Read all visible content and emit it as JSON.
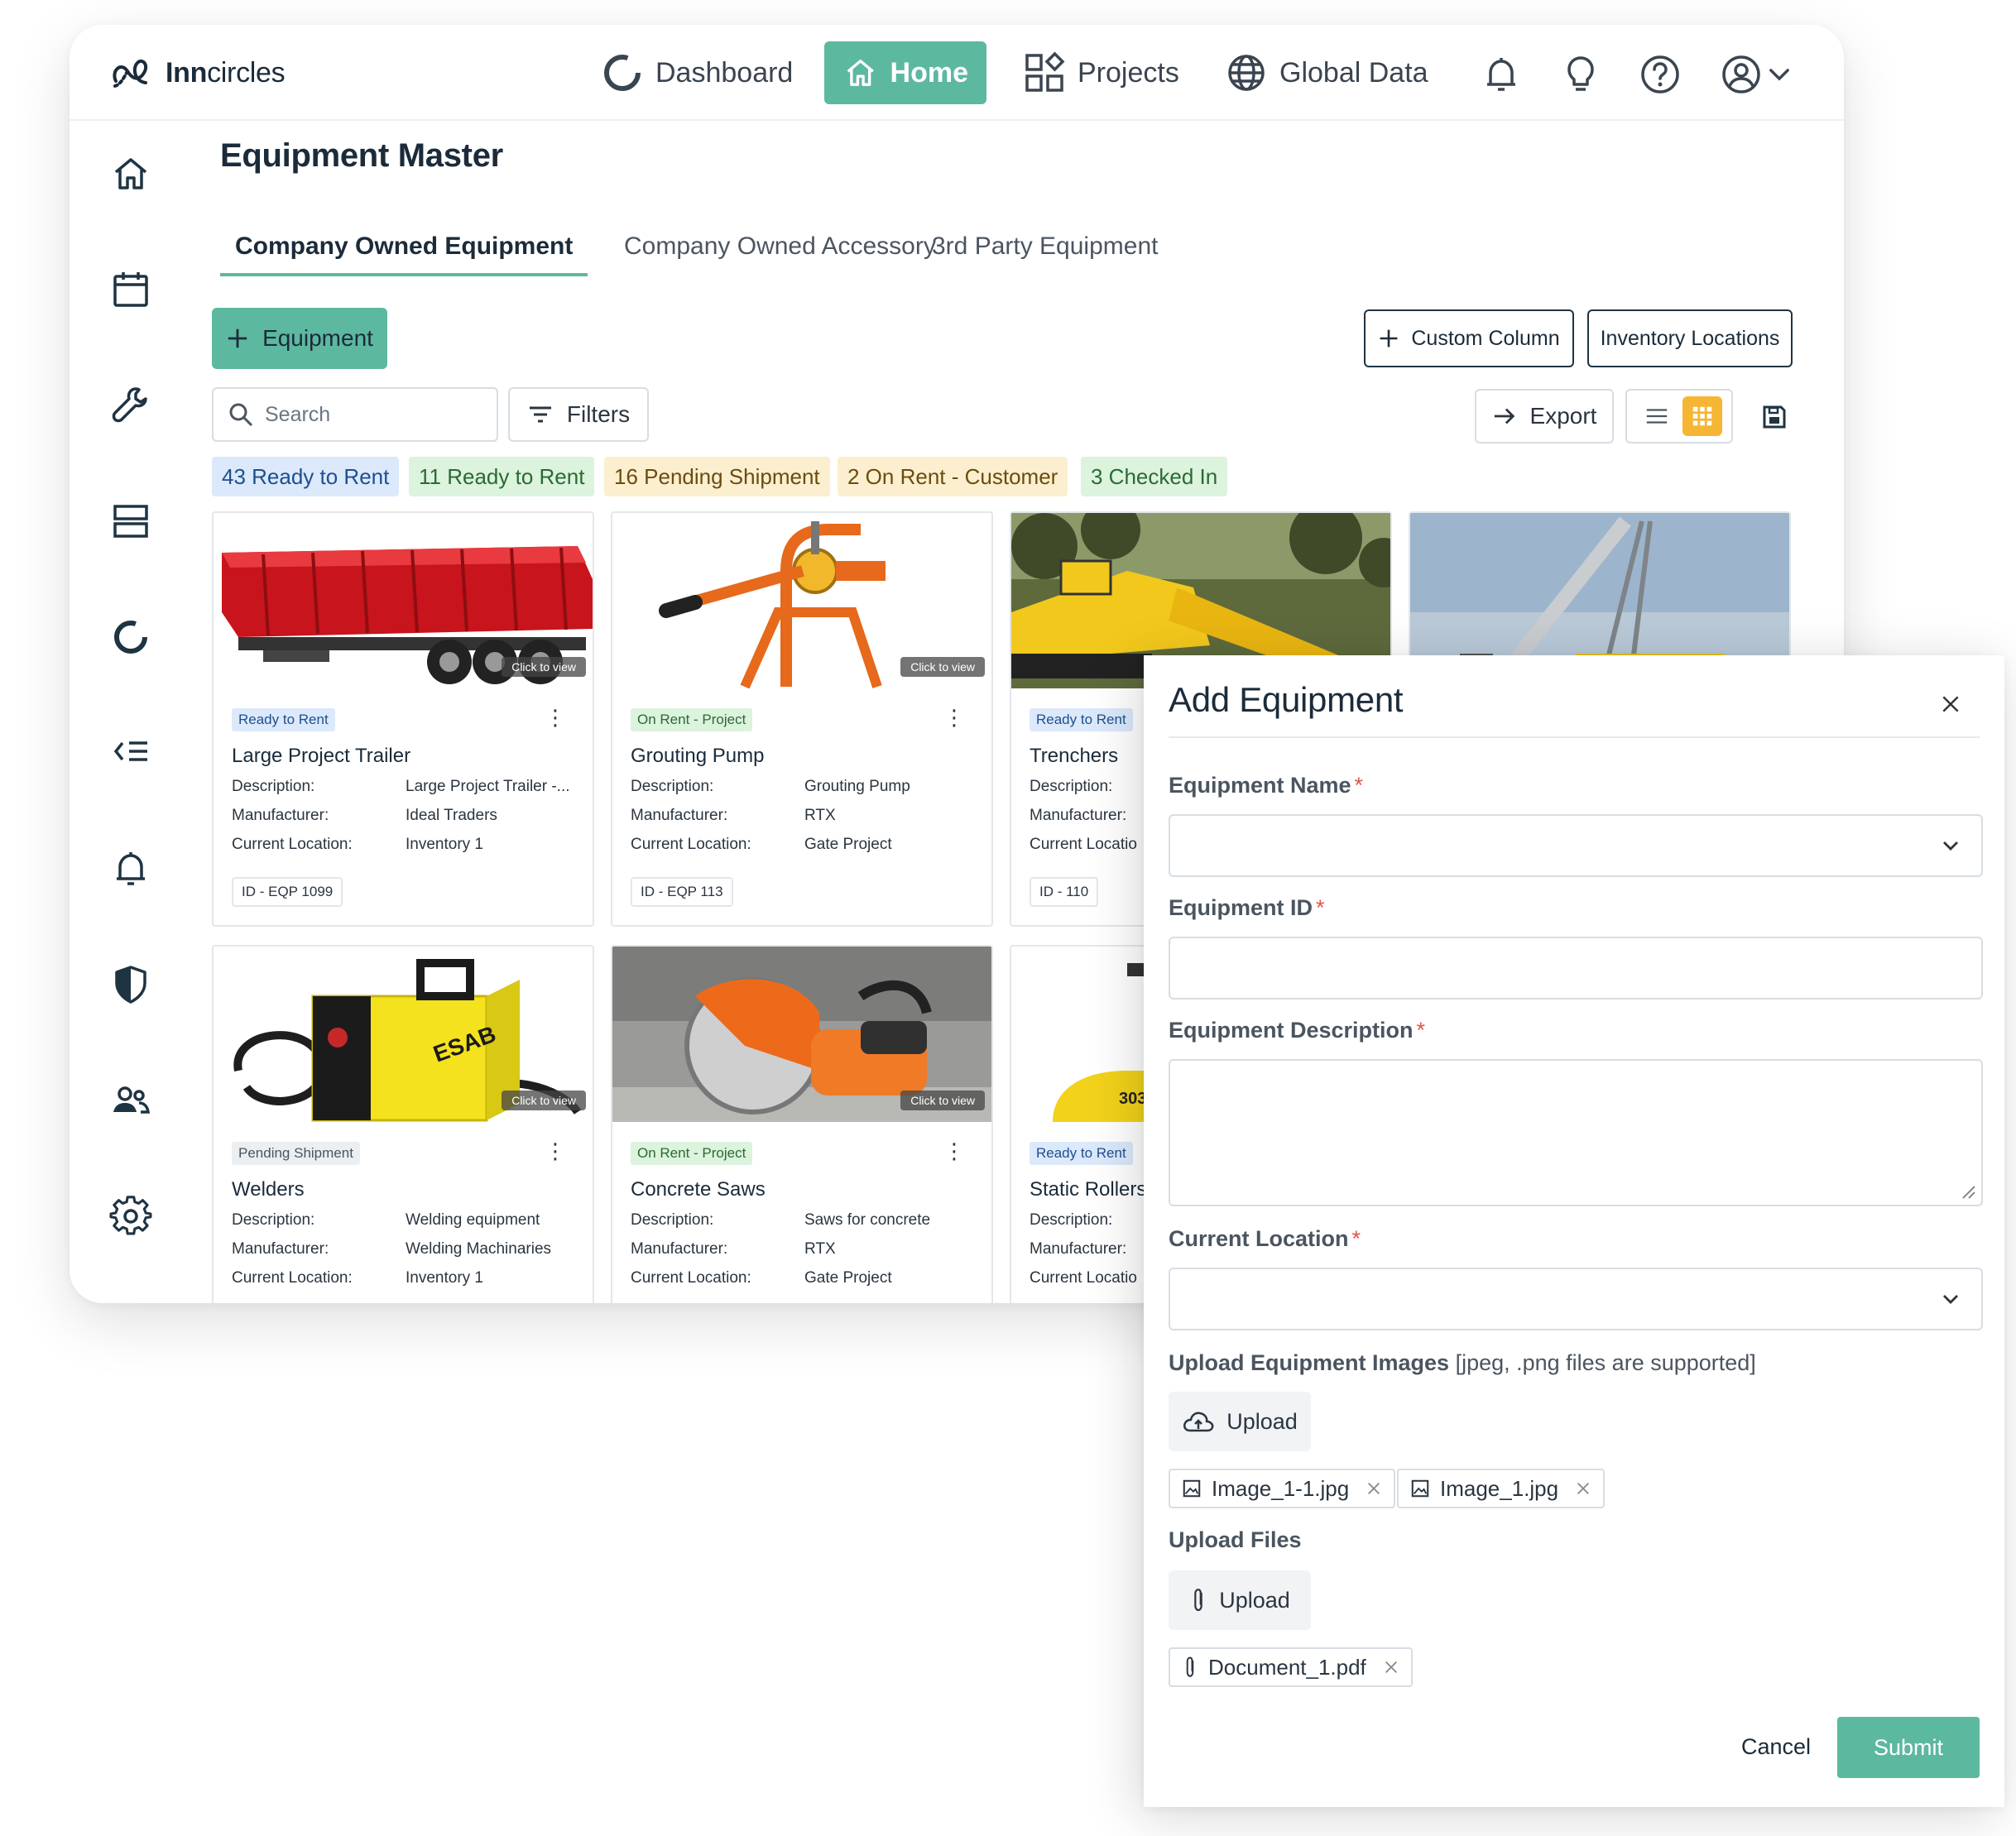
{
  "app": {
    "logo_prefix": "Inn",
    "logo_suffix": "circles",
    "nav": [
      {
        "label": "Dashboard",
        "icon": "dashboard-ring-icon"
      },
      {
        "label": "Home",
        "icon": "home-icon",
        "active": true
      },
      {
        "label": "Projects",
        "icon": "projects-grid-icon"
      },
      {
        "label": "Global Data",
        "icon": "globe-icon"
      }
    ],
    "header_icons": [
      "bell-icon",
      "lightbulb-icon",
      "help-icon",
      "account-icon",
      "chevron-down-icon"
    ],
    "accent_color": "#5db8a0"
  },
  "sidebar": {
    "icons": [
      "home-icon",
      "calendar-icon",
      "wrench-icon",
      "storage-icon",
      "ring-chart-icon",
      "list-icon",
      "bell-icon",
      "shield-icon",
      "users-icon",
      "settings-gear-icon"
    ]
  },
  "page": {
    "title": "Equipment Master",
    "tabs": [
      "Company Owned Equipment",
      "Company Owned Accessory",
      "3rd Party Equipment"
    ],
    "active_tab": "Company Owned Equipment"
  },
  "toolbar": {
    "add_equipment": "Equipment",
    "custom_column": "Custom Column",
    "inventory_locations": "Inventory Locations",
    "search_placeholder": "Search",
    "filters": "Filters",
    "export": "Export",
    "view_mode": "grid"
  },
  "status_chips": [
    {
      "label": "43 Ready to Rent",
      "bg": "#dbe9fb",
      "color": "#1e4f8f"
    },
    {
      "label": "11 Ready to Rent",
      "bg": "#dcf3dd",
      "color": "#2b6a34"
    },
    {
      "label": "16 Pending Shipment",
      "bg": "#fbefcf",
      "color": "#6b4c10"
    },
    {
      "label": "2 On Rent - Customer",
      "bg": "#fbefcf",
      "color": "#6b4c10"
    },
    {
      "label": "3 Checked In",
      "bg": "#dcf3dd",
      "color": "#2b6a34"
    }
  ],
  "card_labels": {
    "description": "Description:",
    "manufacturer": "Manufacturer:",
    "current_location": "Current Location:",
    "current_location_truncated": "Current Locatio",
    "click_to_view": "Click to view"
  },
  "cards": [
    {
      "status": "Ready to Rent",
      "name": "Large Project Trailer",
      "description": "Large Project Trailer -...",
      "manufacturer": "Ideal Traders",
      "location": "Inventory 1",
      "id": "ID - EQP 1099"
    },
    {
      "status": "On Rent - Project",
      "name": "Grouting Pump",
      "description": "Grouting Pump",
      "manufacturer": "RTX",
      "location": "Gate Project",
      "id": "ID - EQP 113"
    },
    {
      "status": "Ready to Rent",
      "name": "Trenchers",
      "id": "ID - 110"
    },
    {
      "status": "Pending Shipment",
      "name": "Welders",
      "description": "Welding equipment",
      "manufacturer": "Welding Machinaries",
      "location": "Inventory 1"
    },
    {
      "status": "On Rent - Project",
      "name": "Concrete Saws",
      "description": "Saws for concrete",
      "manufacturer": "RTX",
      "location": "Gate Project"
    },
    {
      "status": "Ready to Rent",
      "name": "Static Rollers"
    }
  ],
  "image_text": {
    "welder_brand": "ESAB",
    "roller_model": "303"
  },
  "modal": {
    "title": "Add Equipment",
    "fields": {
      "name_label": "Equipment Name",
      "id_label": "Equipment ID",
      "description_label": "Equipment Description",
      "location_label": "Current Location",
      "images_label": "Upload Equipment Images",
      "images_hint": "[jpeg, .png files are supported]",
      "files_label": "Upload Files"
    },
    "required_mark": "*",
    "upload_label": "Upload",
    "images": [
      "Image_1-1.jpg",
      "Image_1.jpg"
    ],
    "files": [
      "Document_1.pdf"
    ],
    "cancel": "Cancel",
    "submit": "Submit"
  }
}
